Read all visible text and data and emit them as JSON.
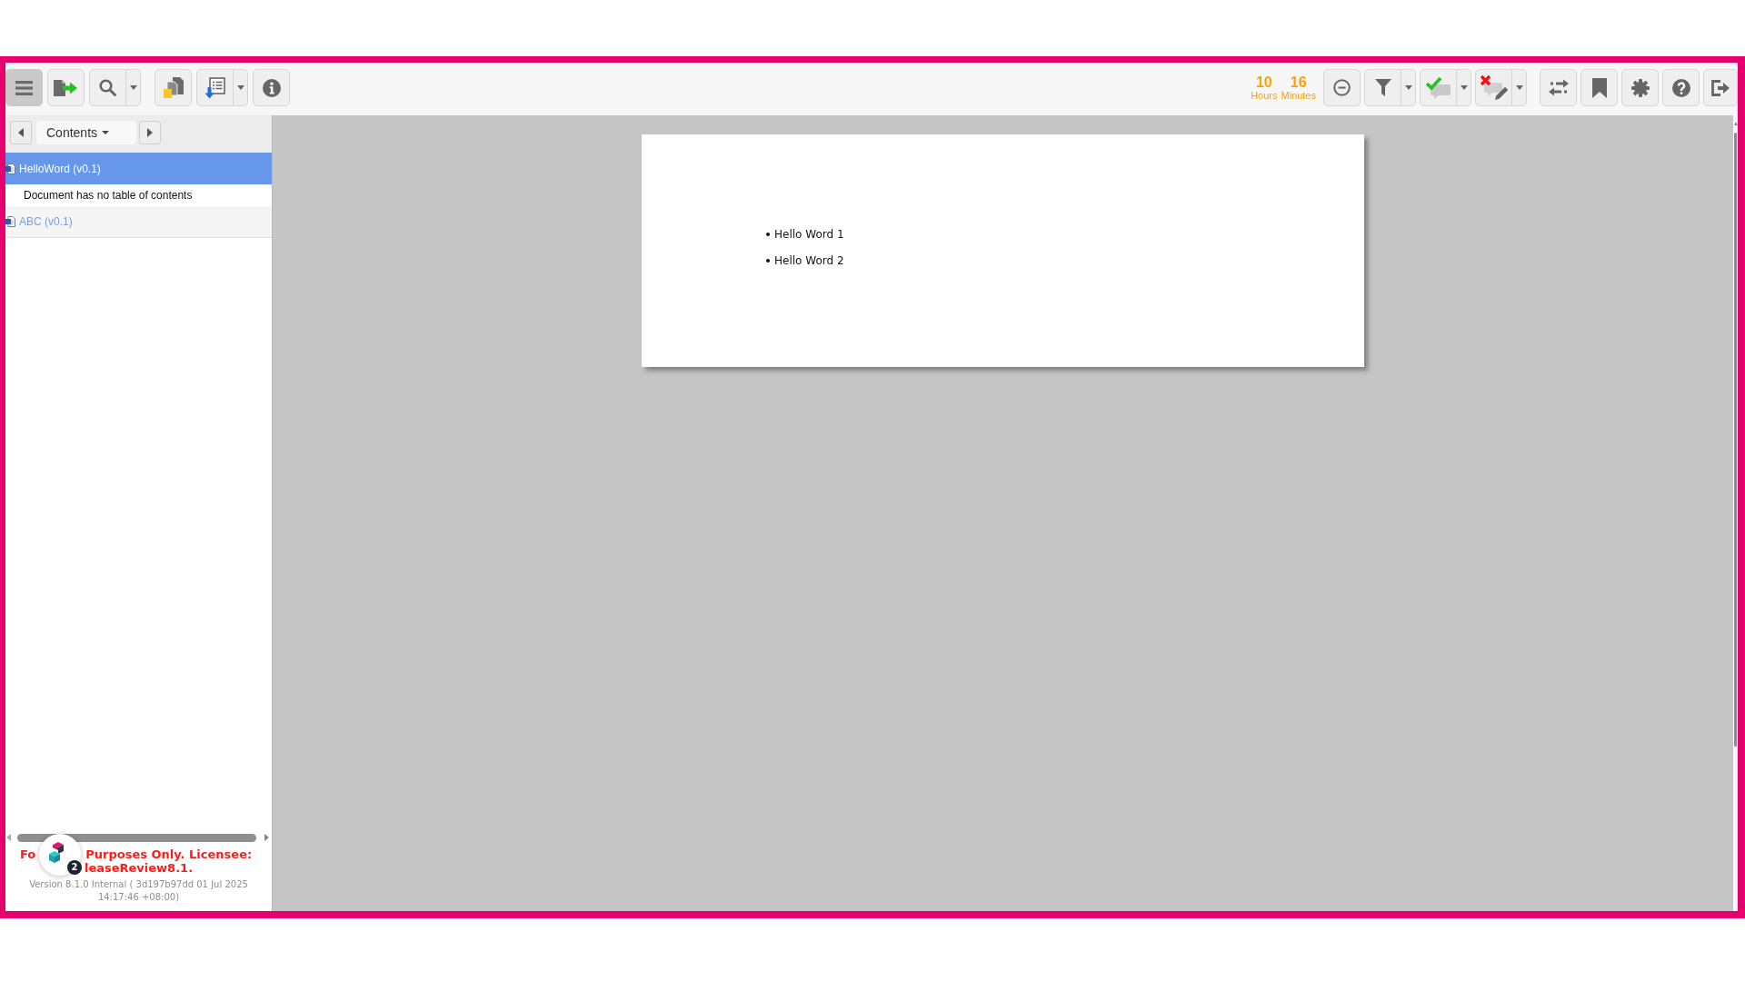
{
  "toolbar": {
    "left_buttons": [
      {
        "pressed": true,
        "has_menu": false
      },
      {
        "pressed": false,
        "has_menu": false
      },
      {
        "pressed": false,
        "has_menu": true
      },
      {
        "pressed": false,
        "has_menu": false
      },
      {
        "pressed": false,
        "has_menu": true
      },
      {
        "pressed": false,
        "has_menu": false
      }
    ],
    "timer": [
      {
        "value": "10",
        "unit": "Hours"
      },
      {
        "value": "16",
        "unit": "Minutes"
      }
    ],
    "right_buttons": [
      {
        "pressed": false,
        "has_menu": false
      },
      {
        "pressed": false,
        "has_menu": true
      },
      {
        "pressed": false,
        "has_menu": true
      },
      {
        "pressed": false,
        "has_menu": true
      },
      {
        "pressed": false,
        "has_menu": false
      },
      {
        "pressed": false,
        "has_menu": false
      },
      {
        "pressed": false,
        "has_menu": false
      },
      {
        "pressed": false,
        "has_menu": false
      },
      {
        "pressed": false,
        "has_menu": false
      }
    ]
  },
  "sidebar": {
    "nav": {
      "label": "Contents"
    },
    "documents": [
      {
        "title": "HelloWord (v0.1)",
        "selected": true,
        "note": "Document has no table of contents"
      },
      {
        "title": "ABC (v0.1)",
        "selected": false
      }
    ],
    "license_notice": {
      "line_1_parts": [
        "Fo",
        "Purposes Only. Licensee:"
      ],
      "line_2": "leaseReview8.1."
    },
    "version": "Version 8.1.0 Internal ( 3d197b97dd 01 Jul 2025 14:17:46 +08:00)"
  },
  "floating_widget": {
    "badge": "2"
  },
  "document": {
    "bullets": [
      "Hello Word 1",
      "Hello Word 2"
    ]
  }
}
